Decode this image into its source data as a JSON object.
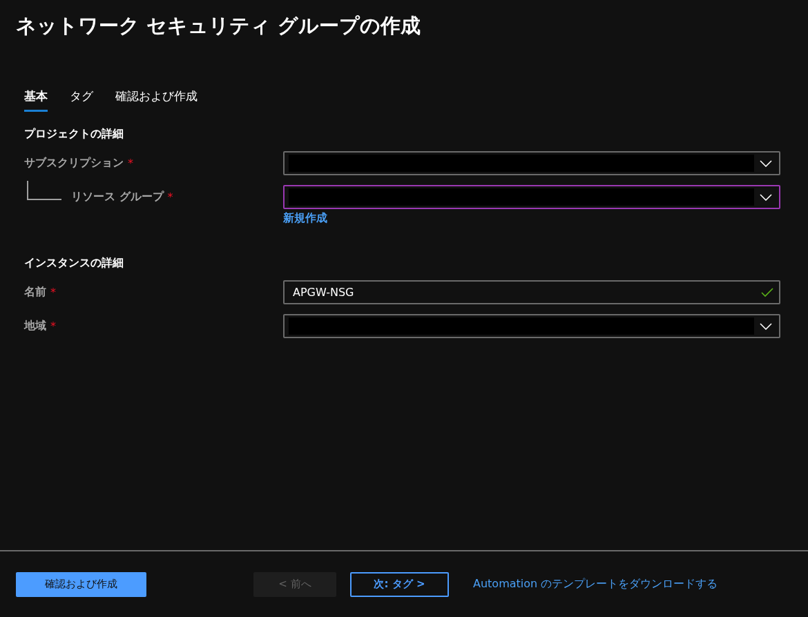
{
  "title": "ネットワーク セキュリティ グループの作成",
  "tabs": [
    {
      "label": "基本",
      "selected": true
    },
    {
      "label": "タグ",
      "selected": false
    },
    {
      "label": "確認および作成",
      "selected": false
    }
  ],
  "sections": [
    {
      "heading": "プロジェクトの詳細",
      "fields": [
        {
          "label": "サブスクリプション",
          "required": "*",
          "kind": "dropdown",
          "redacted": true,
          "focused": false,
          "children": [
            {
              "label": "リソース グループ",
              "required": "*",
              "kind": "dropdown",
              "redacted": true,
              "focused": true,
              "link": "新規作成"
            }
          ]
        }
      ]
    },
    {
      "heading": "インスタンスの詳細",
      "fields": [
        {
          "label": "名前",
          "required": "*",
          "kind": "text",
          "value": "APGW-NSG",
          "valid": true,
          "focused": false
        },
        {
          "label": "地域",
          "required": "*",
          "kind": "dropdown",
          "redacted": true,
          "focused": false
        }
      ]
    }
  ],
  "footer": {
    "buttons": [
      {
        "label": "確認および作成",
        "kind": "primary",
        "disabled": false
      },
      {
        "label": "< 前へ",
        "kind": "secondary",
        "disabled": true
      },
      {
        "label": "次: タグ >",
        "kind": "outline",
        "disabled": false
      }
    ],
    "link": "Automation のテンプレートをダウンロードする"
  }
}
